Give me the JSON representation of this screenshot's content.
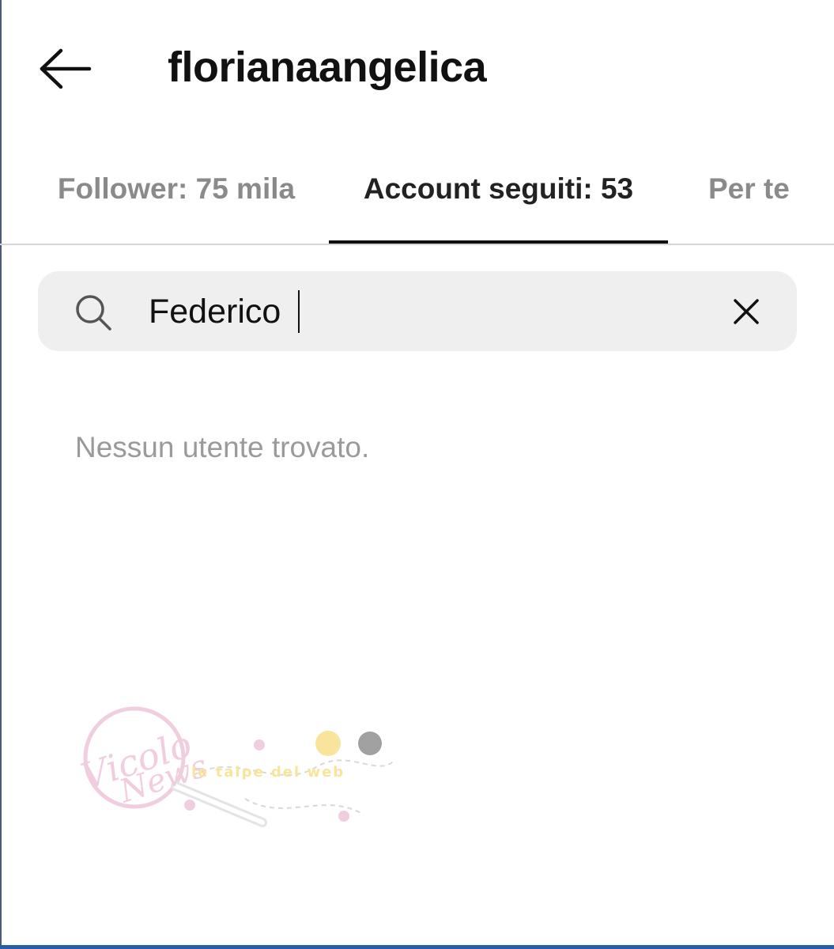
{
  "header": {
    "title": "florianaangelica",
    "back_icon": "arrow-left-icon"
  },
  "tabs": [
    {
      "label": "Follower: 75 mila",
      "active": false
    },
    {
      "label": "Account seguiti: 53",
      "active": true
    },
    {
      "label": "Per te",
      "active": false
    }
  ],
  "search": {
    "value": "Federico",
    "icon": "search-icon",
    "clear_icon": "close-icon"
  },
  "results": {
    "empty_message": "Nessun utente trovato."
  },
  "watermark": {
    "brand": "Vicolo delle News",
    "tagline": "le talpe del web"
  },
  "colors": {
    "active_tab": "#222222",
    "inactive_tab": "#8a8a8a",
    "search_background": "#efefef",
    "empty_text": "#9a9a9a",
    "watermark_pink": "#e7a6c7"
  }
}
